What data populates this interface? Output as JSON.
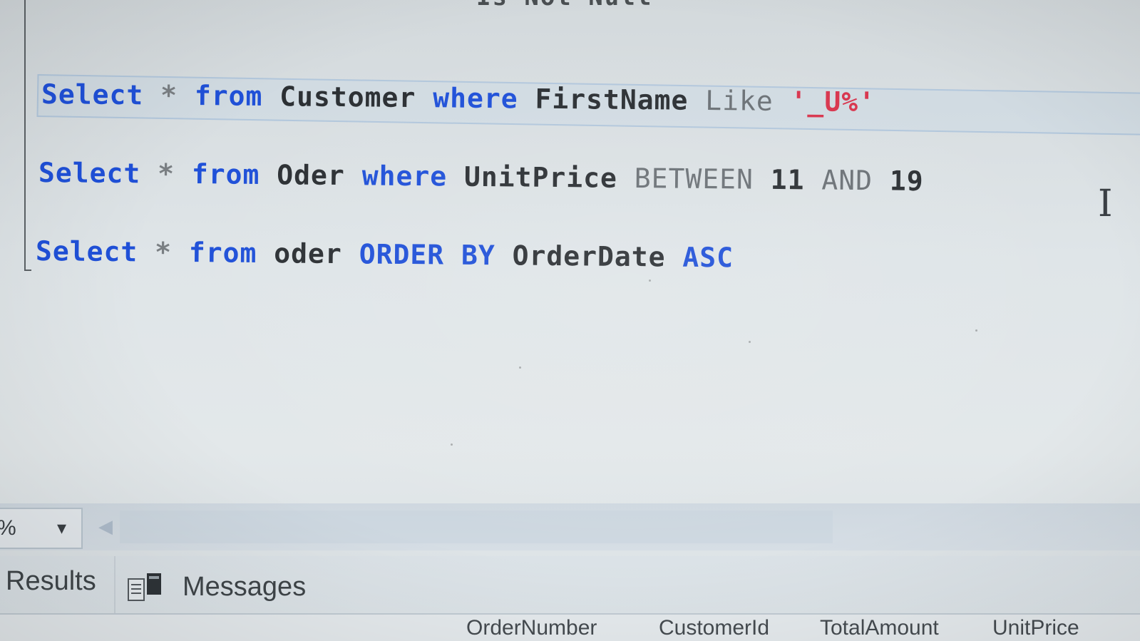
{
  "editor": {
    "partial_top_line": "Is Not Null",
    "lines": [
      {
        "tokens": [
          {
            "text": "Select",
            "kind": "kw"
          },
          {
            "text": " * ",
            "kind": "op"
          },
          {
            "text": "from",
            "kind": "kw"
          },
          {
            "text": " Customer ",
            "kind": "id"
          },
          {
            "text": "where",
            "kind": "kw"
          },
          {
            "text": " FirstName ",
            "kind": "id"
          },
          {
            "text": "Like",
            "kind": "fn"
          },
          {
            "text": " '_U%'",
            "kind": "str"
          }
        ]
      },
      {
        "tokens": [
          {
            "text": "Select",
            "kind": "kw"
          },
          {
            "text": " * ",
            "kind": "op"
          },
          {
            "text": "from",
            "kind": "kw"
          },
          {
            "text": " Oder ",
            "kind": "id"
          },
          {
            "text": "where",
            "kind": "kw"
          },
          {
            "text": " UnitPrice ",
            "kind": "id"
          },
          {
            "text": "BETWEEN",
            "kind": "fn"
          },
          {
            "text": " 11 ",
            "kind": "num"
          },
          {
            "text": "AND",
            "kind": "fn"
          },
          {
            "text": " 19",
            "kind": "num"
          }
        ]
      },
      {
        "tokens": [
          {
            "text": "Select",
            "kind": "kw"
          },
          {
            "text": " * ",
            "kind": "op"
          },
          {
            "text": "from",
            "kind": "kw"
          },
          {
            "text": " oder ",
            "kind": "id"
          },
          {
            "text": "ORDER BY",
            "kind": "kw"
          },
          {
            "text": " OrderDate ",
            "kind": "id"
          },
          {
            "text": "ASC",
            "kind": "kw"
          }
        ]
      }
    ]
  },
  "toolbar": {
    "zoom_value": "%",
    "zoom_arrow": "▾",
    "scroll_left": "◀"
  },
  "tabs": {
    "results_label": "Results",
    "messages_label": "Messages"
  },
  "grid": {
    "columns": [
      "OrderNumber",
      "CustomerId",
      "TotalAmount",
      "UnitPrice"
    ]
  },
  "colors": {
    "keyword": "#1f50d8",
    "identifier": "#2b2f33",
    "string": "#d8354d",
    "gray_keyword": "#6b7176"
  }
}
